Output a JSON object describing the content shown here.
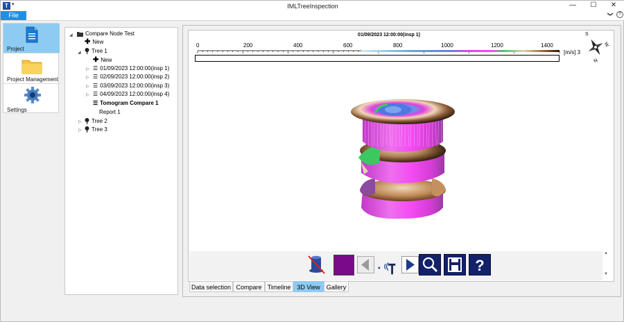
{
  "window": {
    "title": "IMLTreeInspection",
    "app_icon_glyph": "T",
    "quick_access_glyph": "▾",
    "minimize_glyph": "—",
    "maximize_glyph": "☐",
    "close_glyph": "✕"
  },
  "ribbon": {
    "file_tab": "File",
    "collapse_glyph": "❯",
    "help_glyph": "?"
  },
  "nav": {
    "items": [
      {
        "label": "Project",
        "icon": "document-icon",
        "selected": true
      },
      {
        "label": "Project Management",
        "icon": "folder-icon",
        "selected": false
      },
      {
        "label": "Settings",
        "icon": "gear-icon",
        "selected": false
      }
    ]
  },
  "tree": {
    "root": "Compare Node Test",
    "root_new": "New",
    "tree1": "Tree 1",
    "tree1_new": "New",
    "inspections": [
      "01/09/2023 12:00:00(insp 1)",
      "02/09/2023 12:00:00(insp 2)",
      "03/09/2023 12:00:00(insp 3)",
      "04/09/2023 12:00:00(insp 4)"
    ],
    "tomogram": "Tomogram Compare 1",
    "report": "Report 1",
    "tree2": "Tree 2",
    "tree3": "Tree 3",
    "expand_glyph": "▷",
    "collapse_glyph": "◢"
  },
  "viewer": {
    "title": "01/09/2023 12:00:00(insp 1)",
    "scale_ticks": [
      "0",
      "200",
      "400",
      "600",
      "800",
      "1000",
      "1200",
      "1400"
    ],
    "scale_unit": "[m/s]",
    "scale_unit_suffix": "3.",
    "compass": {
      "s": "S",
      "w": "W",
      "n": "N"
    },
    "selected_color": "#7a0a8a",
    "scroll_up": "▲",
    "scroll_down": "▼"
  },
  "tabs": [
    {
      "label": "Data selection",
      "active": false
    },
    {
      "label": "Compare",
      "active": false
    },
    {
      "label": "Timeline",
      "active": false
    },
    {
      "label": "3D View",
      "active": true
    },
    {
      "label": "Gallery",
      "active": false
    }
  ]
}
